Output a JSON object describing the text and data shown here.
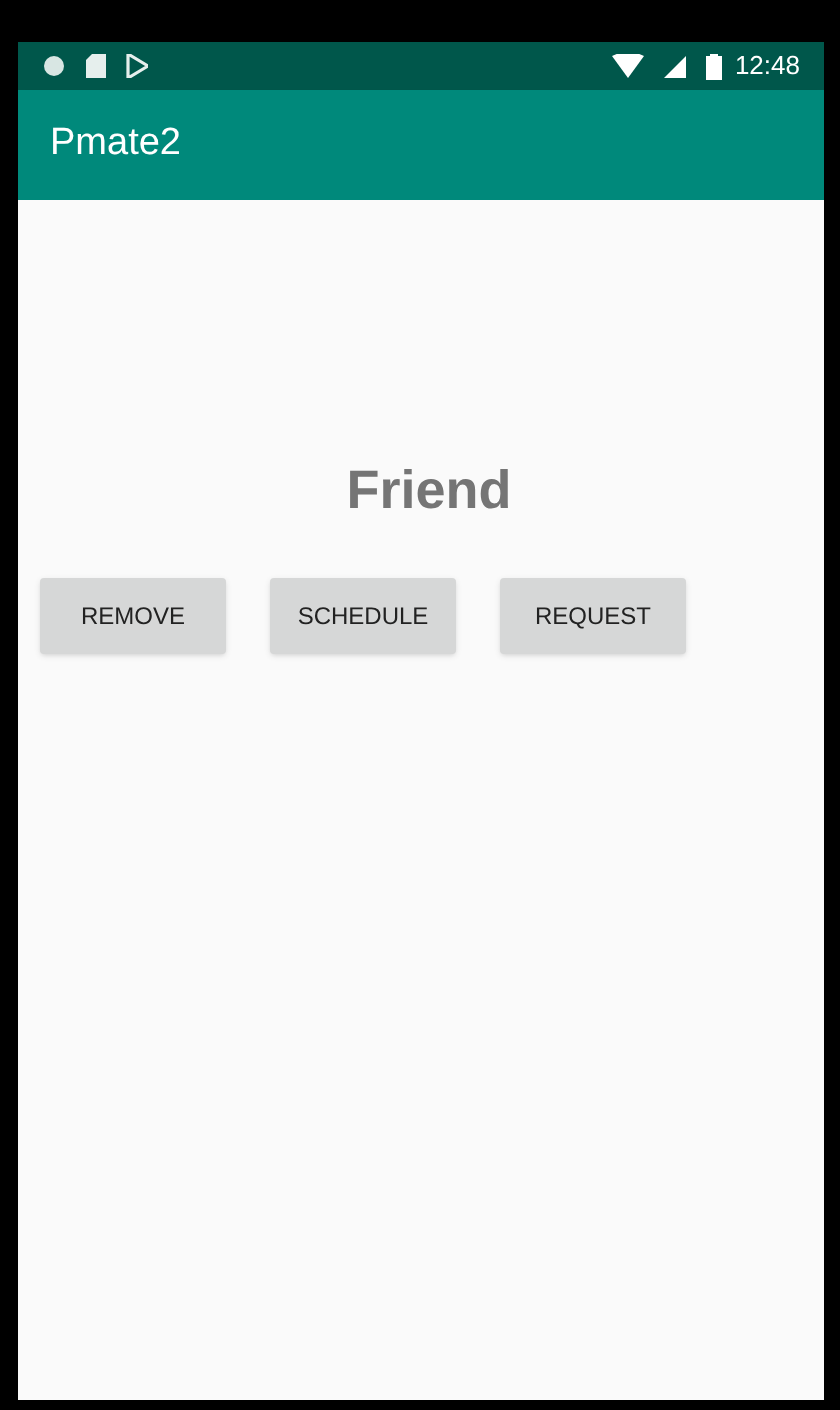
{
  "status_bar": {
    "time": "12:48"
  },
  "app_bar": {
    "title": "Pmate2"
  },
  "heading": "Friend",
  "buttons": [
    "REMOVE",
    "SCHEDULE",
    "REQUEST"
  ]
}
